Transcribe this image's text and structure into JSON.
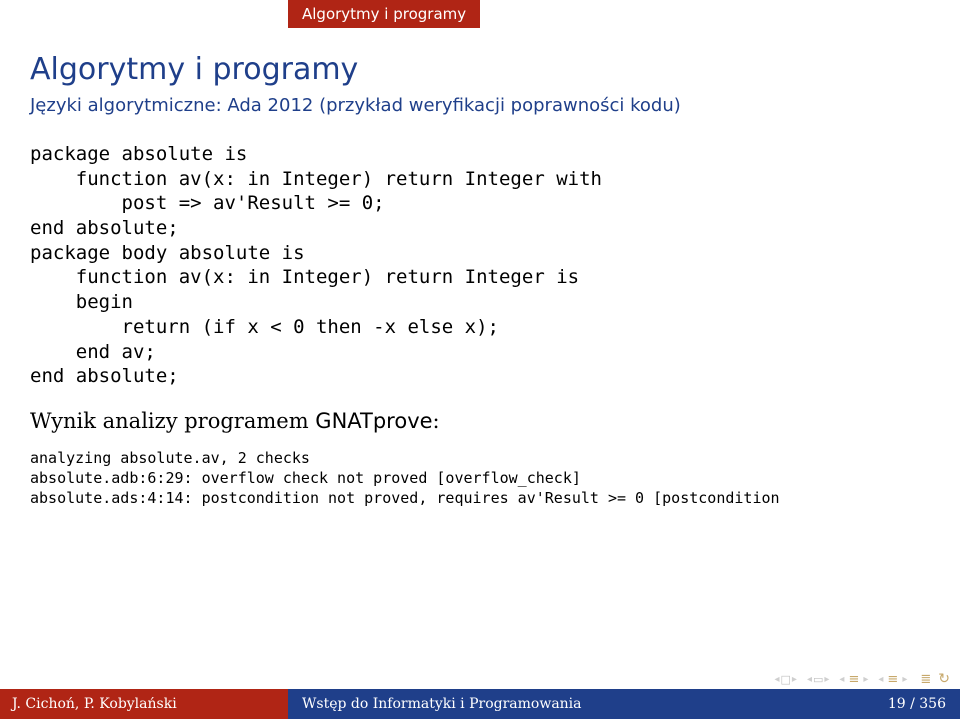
{
  "header": {
    "tab": "Algorytmy i programy"
  },
  "title": "Algorytmy i programy",
  "subtitle": "Języki algorytmiczne: Ada 2012 (przykład weryfikacji poprawności kodu)",
  "code_block": "package absolute is\n    function av(x: in Integer) return Integer with\n        post => av'Result >= 0;\nend absolute;\npackage body absolute is\n    function av(x: in Integer) return Integer is\n    begin\n        return (if x < 0 then -x else x);\n    end av;\nend absolute;",
  "analysis_heading_prefix": "Wynik analizy programem ",
  "analysis_heading_bold": "GNATprove",
  "analysis_heading_suffix": ":",
  "analysis_output": "analyzing absolute.av, 2 checks\nabsolute.adb:6:29: overflow check not proved [overflow_check]\nabsolute.ads:4:14: postcondition not proved, requires av'Result >= 0 [postcondition",
  "footer": {
    "authors": "J. Cichoń, P. Kobylański",
    "center": "Wstęp do Informatyki i Programowania",
    "page": "19 / 356"
  }
}
